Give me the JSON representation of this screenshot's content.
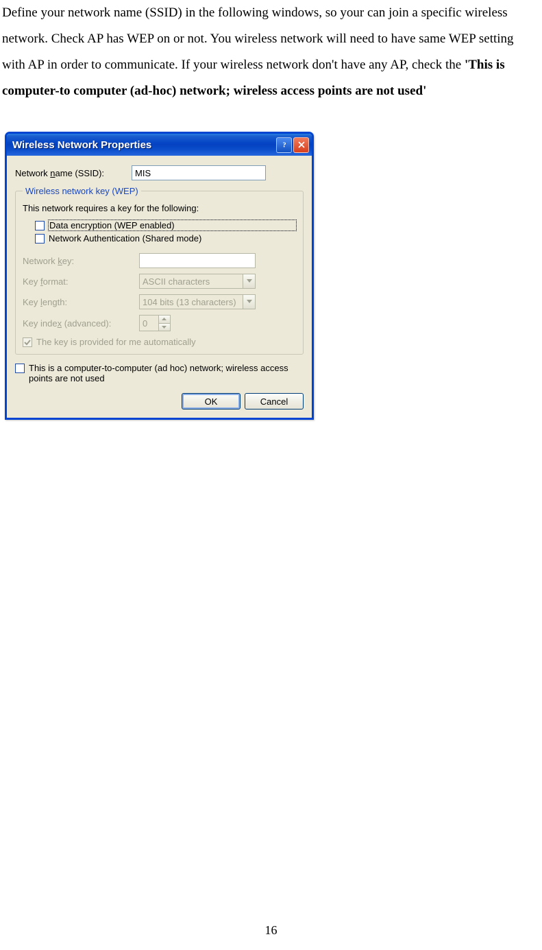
{
  "instruction": {
    "part1": "Define your network name (SSID) in the following windows, so your can join a specific wireless network. Check AP has WEP on or not. You wireless network will need to have same WEP setting with AP in order to communicate. If your wireless network don't have any AP, check the  ",
    "part2_bold": "'This is computer-to computer (ad-hoc) network; wireless access points are not used'"
  },
  "dialog": {
    "title": "Wireless Network Properties",
    "network_name_label_pre": "Network ",
    "network_name_label_ul": "n",
    "network_name_label_post": "ame (SSID):",
    "network_name_value": "MIS",
    "group_legend": "Wireless network key (WEP)",
    "group_desc": "This network requires a key for the following:",
    "chk_data_enc_pre": "",
    "chk_data_enc_ul": "D",
    "chk_data_enc_post": "ata encryption (WEP enabled)",
    "chk_net_auth_pre": "Network ",
    "chk_net_auth_ul": "A",
    "chk_net_auth_post": "uthentication (Shared mode)",
    "key_label_pre": "Network ",
    "key_label_ul": "k",
    "key_label_post": "ey:",
    "key_value": "",
    "format_label_pre": "Key ",
    "format_label_ul": "f",
    "format_label_post": "ormat:",
    "format_value": "ASCII characters",
    "length_label_pre": "Key ",
    "length_label_ul": "l",
    "length_label_post": "ength:",
    "length_value": "104 bits (13 characters)",
    "index_label_pre": "Key inde",
    "index_label_ul": "x",
    "index_label_post": " (advanced):",
    "index_value": "0",
    "auto_key_pre": "T",
    "auto_key_ul": "h",
    "auto_key_post": "e key is provided for me automatically",
    "adhoc_pre": "This is a ",
    "adhoc_ul": "c",
    "adhoc_post": "omputer-to-computer (ad hoc) network; wireless access points are not used",
    "ok_label": "OK",
    "cancel_label": "Cancel"
  },
  "page_number": "16"
}
